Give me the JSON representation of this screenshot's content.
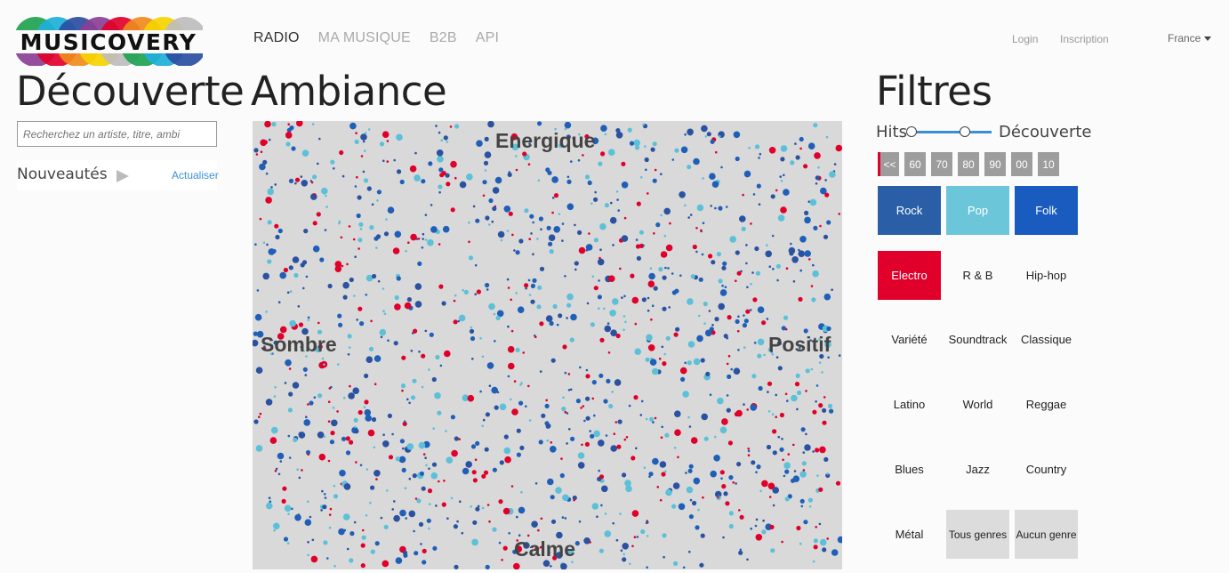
{
  "logo": {
    "text": "MUSICOVERY",
    "arc_colors": [
      "#1fa351",
      "#1eb0d8",
      "#2b4ea2",
      "#8b3f95",
      "#e2002a",
      "#f08a1c",
      "#f6d300",
      "#bdbdbd"
    ]
  },
  "nav": {
    "items": [
      "RADIO",
      "MA MUSIQUE",
      "B2B",
      "API"
    ],
    "active": "RADIO"
  },
  "account": {
    "login": "Login",
    "signup": "Inscription"
  },
  "country": {
    "selected": "France"
  },
  "left": {
    "title": "Découverte",
    "search_placeholder": "Recherchez un artiste, titre, ambi",
    "news_label": "Nouveautés",
    "refresh_label": "Actualiser"
  },
  "mood": {
    "title": "Ambiance",
    "labels": {
      "top": "Energique",
      "left": "Sombre",
      "right": "Positif",
      "bottom": "Calme"
    },
    "dot_colors": [
      "#1f5fb8",
      "#5bc0d8",
      "#e0002a",
      "#2a52a0"
    ]
  },
  "filters": {
    "title": "Filtres",
    "hits_label": "Hits",
    "discovery_label": "Découverte",
    "decades": [
      "<<",
      "60",
      "70",
      "80",
      "90",
      "00",
      "10"
    ],
    "genres": [
      {
        "label": "Rock",
        "bg": "#2a5fa8",
        "fg": "#ffffff"
      },
      {
        "label": "Pop",
        "bg": "#6cc6d9",
        "fg": "#ffffff"
      },
      {
        "label": "Folk",
        "bg": "#1a5bbf",
        "fg": "#ffffff"
      },
      {
        "label": "Electro",
        "bg": "#e0002a",
        "fg": "#ffffff"
      },
      {
        "label": "R & B",
        "bg": "transparent",
        "fg": "#222222"
      },
      {
        "label": "Hip-hop",
        "bg": "transparent",
        "fg": "#222222"
      },
      {
        "label": "Variété",
        "bg": "transparent",
        "fg": "#222222"
      },
      {
        "label": "Soundtrack",
        "bg": "transparent",
        "fg": "#222222"
      },
      {
        "label": "Classique",
        "bg": "transparent",
        "fg": "#222222"
      },
      {
        "label": "Latino",
        "bg": "transparent",
        "fg": "#222222"
      },
      {
        "label": "World",
        "bg": "transparent",
        "fg": "#222222"
      },
      {
        "label": "Reggae",
        "bg": "transparent",
        "fg": "#222222"
      },
      {
        "label": "Blues",
        "bg": "transparent",
        "fg": "#222222"
      },
      {
        "label": "Jazz",
        "bg": "transparent",
        "fg": "#222222"
      },
      {
        "label": "Country",
        "bg": "transparent",
        "fg": "#222222"
      },
      {
        "label": "Métal",
        "bg": "transparent",
        "fg": "#222222"
      },
      {
        "label": "Tous genres",
        "bg": "#dcdcdc",
        "fg": "#222222"
      },
      {
        "label": "Aucun genre",
        "bg": "#dcdcdc",
        "fg": "#222222"
      }
    ]
  }
}
